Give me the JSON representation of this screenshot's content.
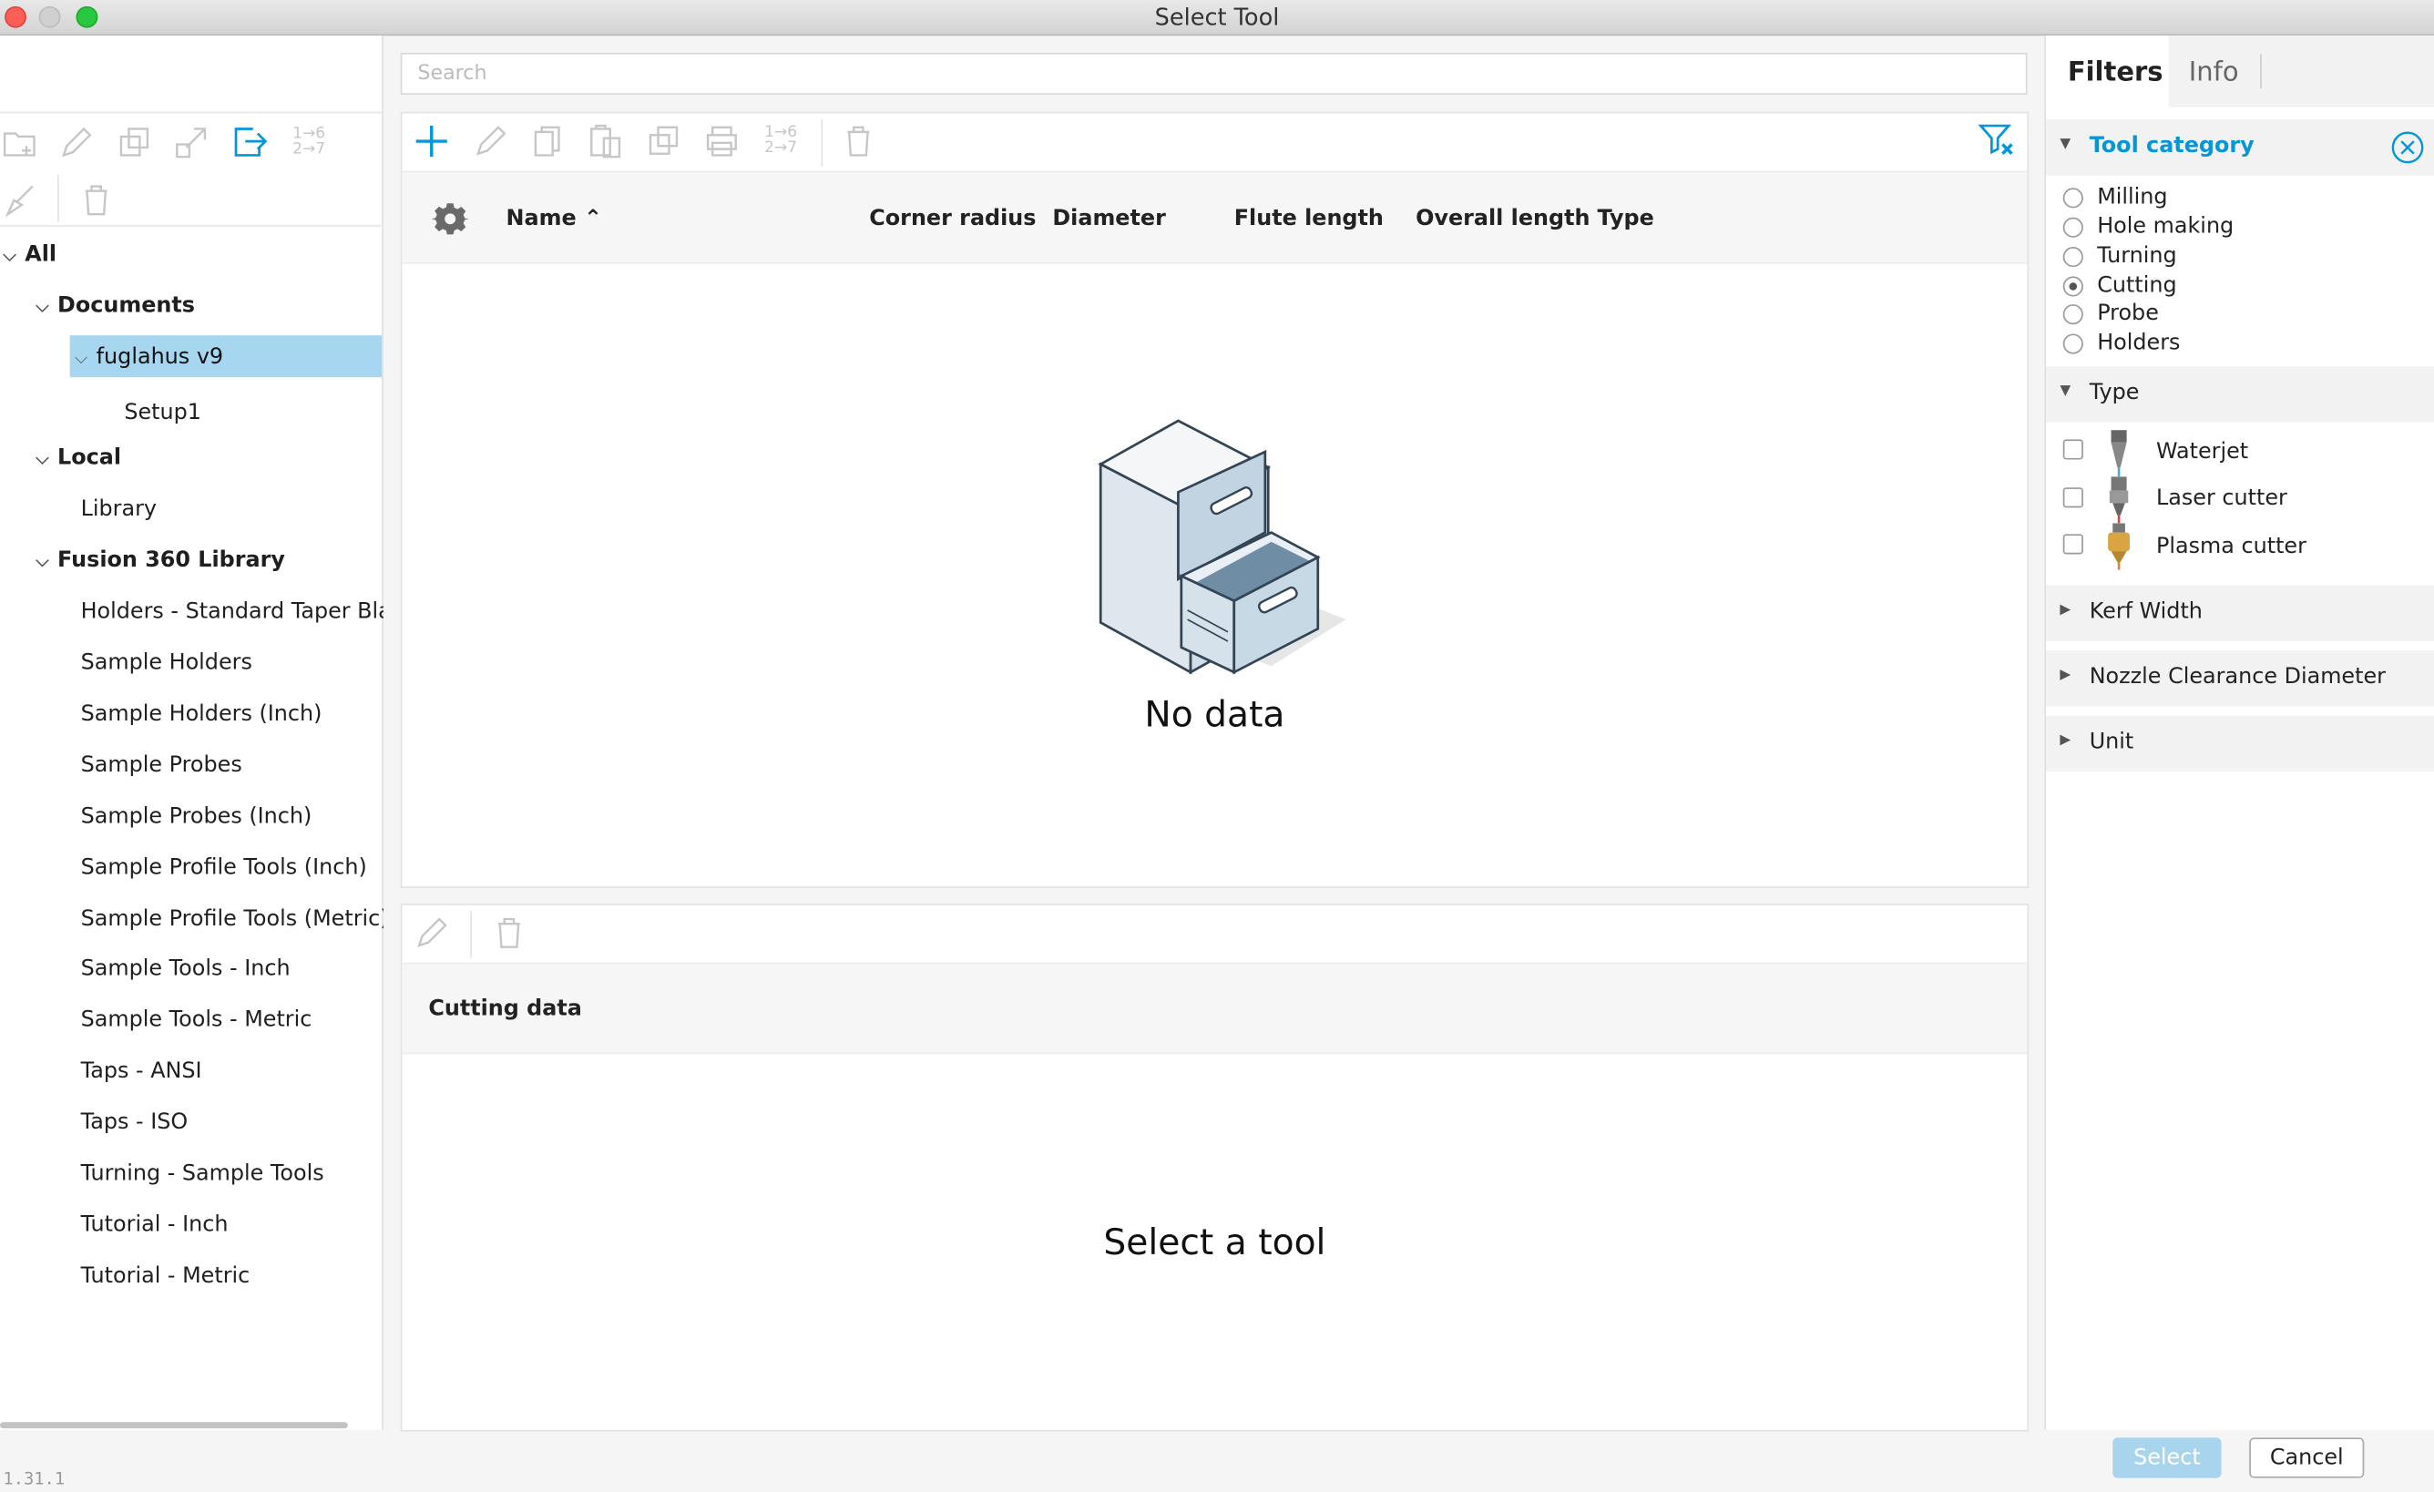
{
  "window": {
    "title": "Select Tool"
  },
  "search": {
    "placeholder": "Search"
  },
  "tree": {
    "all": "All",
    "documents": "Documents",
    "doc": "fuglahus v9",
    "setup": "Setup1",
    "local": "Local",
    "library": "Library",
    "fusion": "Fusion 360 Library",
    "libs": [
      "Holders - Standard Taper Blanks",
      "Sample Holders",
      "Sample Holders (Inch)",
      "Sample Probes",
      "Sample Probes (Inch)",
      "Sample Profile Tools (Inch)",
      "Sample Profile Tools (Metric)",
      "Sample Tools - Inch",
      "Sample Tools - Metric",
      "Taps - ANSI",
      "Taps - ISO",
      "Turning - Sample Tools",
      "Tutorial - Inch",
      "Tutorial - Metric"
    ]
  },
  "table": {
    "columns": [
      "Name",
      "Corner radius",
      "Diameter",
      "Flute length",
      "Overall length",
      "Type"
    ],
    "sort_column": "Name",
    "sort_dir": "ascending",
    "empty": "No data"
  },
  "cutting": {
    "header": "Cutting data",
    "empty": "Select a tool"
  },
  "filters": {
    "tabs": [
      "Filters",
      "Info"
    ],
    "tool_category": {
      "label": "Tool category",
      "options": [
        "Milling",
        "Hole making",
        "Turning",
        "Cutting",
        "Probe",
        "Holders"
      ],
      "selected": "Cutting"
    },
    "type": {
      "label": "Type",
      "options": [
        "Waterjet",
        "Laser cutter",
        "Plasma cutter"
      ]
    },
    "kerf": "Kerf Width",
    "nozzle": "Nozzle Clearance Diameter",
    "unit": "Unit"
  },
  "footer": {
    "version": "1.31.1",
    "select": "Select",
    "cancel": "Cancel"
  },
  "colors": {
    "accent": "#0696d7",
    "selected_row": "#a6d6f0",
    "select_button": "#a8d4ee"
  }
}
